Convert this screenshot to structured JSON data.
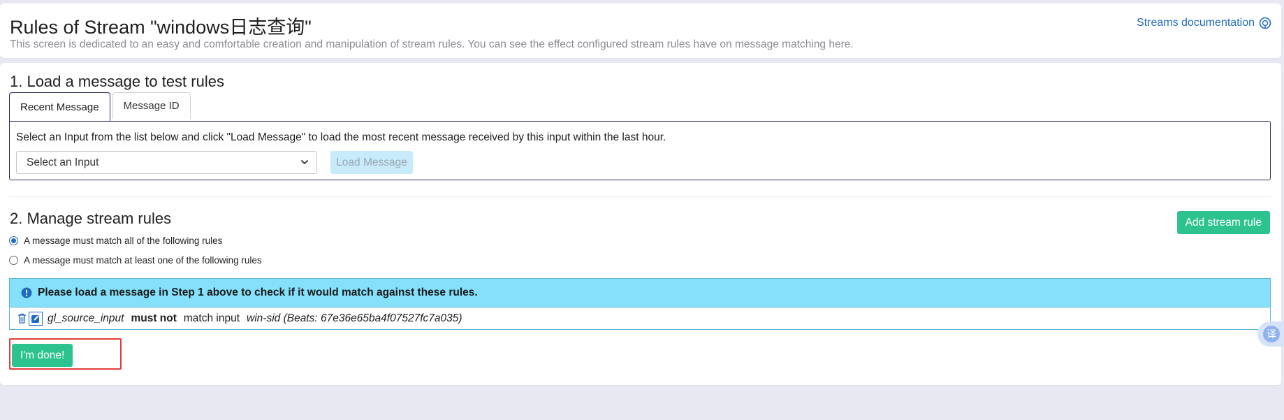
{
  "header": {
    "title": "Rules of Stream \"windows日志查询\"",
    "description": "This screen is dedicated to an easy and comfortable creation and manipulation of stream rules. You can see the effect configured stream rules have on message matching here.",
    "docs_link": "Streams documentation",
    "docs_icon": "help-circle-icon"
  },
  "step1": {
    "title": "1. Load a message to test rules",
    "tabs": [
      {
        "label": "Recent Message",
        "active": true
      },
      {
        "label": "Message ID",
        "active": false
      }
    ],
    "instruction": "Select an Input from the list below and click \"Load Message\" to load the most recent message received by this input within the last hour.",
    "select_value": "Select an Input",
    "load_button": "Load Message"
  },
  "step2": {
    "title": "2. Manage stream rules",
    "add_button": "Add stream rule",
    "radio_all": "A message must match all of the following rules",
    "radio_any": "A message must match at least one of the following rules",
    "radio_selected": "all",
    "alert": "Please load a message in Step 1 above to check if it would match against these rules.",
    "rule": {
      "field": "gl_source_input",
      "condition": "must not",
      "match_text": "match input",
      "value": "win-sid (Beats: 67e36e65ba4f07527fc7a035)"
    },
    "done_button": "I'm done!"
  },
  "translate_fab": "译",
  "colors": {
    "accent_green": "#2dc38e",
    "link_blue": "#1f6ac3",
    "alert_bg": "#85e0fb",
    "highlight_red": "#e23b3b"
  }
}
